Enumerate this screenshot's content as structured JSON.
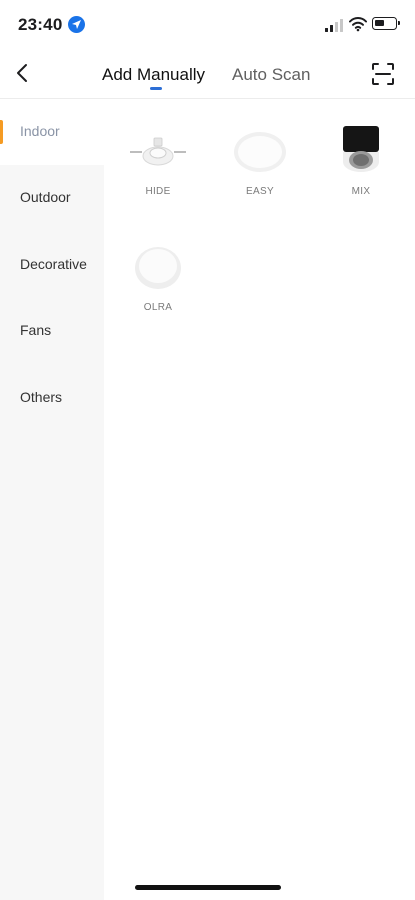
{
  "status_bar": {
    "time": "23:40",
    "icons": [
      "location-icon",
      "signal-icon",
      "wifi-icon",
      "battery-icon"
    ]
  },
  "nav": {
    "tabs": [
      {
        "label": "Add Manually",
        "active": true
      },
      {
        "label": "Auto Scan",
        "active": false
      }
    ],
    "back_icon": "chevron-left-icon",
    "scan_icon": "scan-frame-icon"
  },
  "sidebar": {
    "items": [
      {
        "label": "Indoor",
        "active": true
      },
      {
        "label": "Outdoor",
        "active": false
      },
      {
        "label": "Decorative",
        "active": false
      },
      {
        "label": "Fans",
        "active": false
      },
      {
        "label": "Others",
        "active": false
      }
    ]
  },
  "products": [
    {
      "name": "HIDE"
    },
    {
      "name": "EASY"
    },
    {
      "name": "MIX"
    },
    {
      "name": "OLRA"
    }
  ],
  "colors": {
    "accent_blue": "#2d6fd6",
    "active_indicator": "#f59b23",
    "sidebar_bg": "#f7f7f7"
  }
}
